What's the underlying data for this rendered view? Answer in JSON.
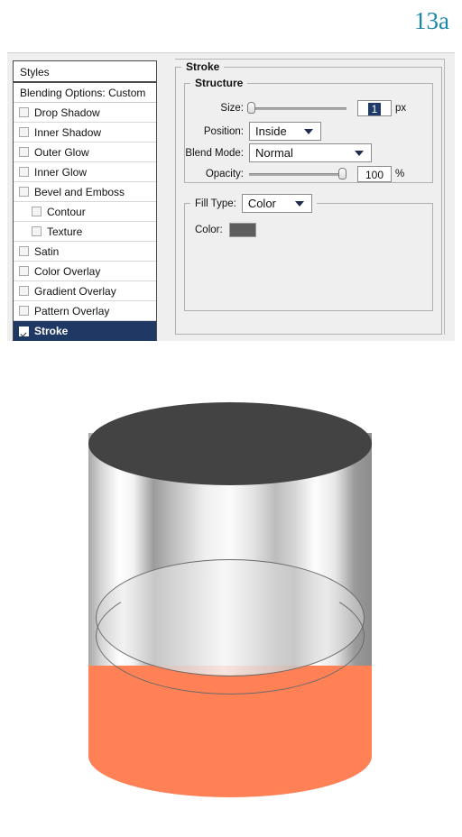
{
  "figure": {
    "label": "13a",
    "label_color": "#1b87a8"
  },
  "dialog": {
    "styles_panel": {
      "header": "Styles",
      "blending_options": "Blending Options: Custom",
      "items": [
        {
          "label": "Drop Shadow",
          "checked": false,
          "indent": false,
          "selected": false
        },
        {
          "label": "Inner Shadow",
          "checked": false,
          "indent": false,
          "selected": false
        },
        {
          "label": "Outer Glow",
          "checked": false,
          "indent": false,
          "selected": false
        },
        {
          "label": "Inner Glow",
          "checked": false,
          "indent": false,
          "selected": false
        },
        {
          "label": "Bevel and Emboss",
          "checked": false,
          "indent": false,
          "selected": false
        },
        {
          "label": "Contour",
          "checked": false,
          "indent": true,
          "selected": false
        },
        {
          "label": "Texture",
          "checked": false,
          "indent": true,
          "selected": false
        },
        {
          "label": "Satin",
          "checked": false,
          "indent": false,
          "selected": false
        },
        {
          "label": "Color Overlay",
          "checked": false,
          "indent": false,
          "selected": false
        },
        {
          "label": "Gradient Overlay",
          "checked": false,
          "indent": false,
          "selected": false
        },
        {
          "label": "Pattern Overlay",
          "checked": false,
          "indent": false,
          "selected": false
        },
        {
          "label": "Stroke",
          "checked": true,
          "indent": false,
          "selected": true
        }
      ],
      "selected_color": "#1f3864"
    },
    "stroke_panel": {
      "title": "Stroke",
      "structure": {
        "title": "Structure",
        "size_label": "Size:",
        "size_value": "1",
        "size_unit": "px",
        "size_slider_percent": 2,
        "position_label": "Position:",
        "position_value": "Inside",
        "blend_mode_label": "Blend Mode:",
        "blend_mode_value": "Normal",
        "opacity_label": "Opacity:",
        "opacity_value": "100",
        "opacity_unit": "%",
        "opacity_slider_percent": 100
      },
      "fill": {
        "fill_type_label": "Fill Type:",
        "fill_type_value": "Color",
        "color_label": "Color:",
        "color_value": "#5e5e5e"
      }
    }
  },
  "illustration": {
    "name": "metallic-cylinder-with-orange-liquid",
    "top_color": "#434343",
    "liquid_color": "#ff8155",
    "body_finish": "brushed-metal-gradient"
  }
}
